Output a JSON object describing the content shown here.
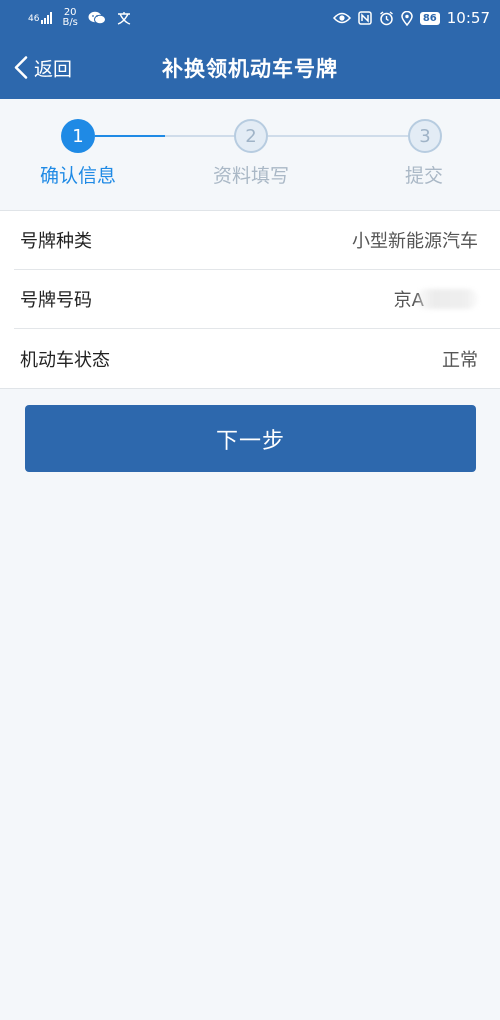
{
  "status_bar": {
    "signal_label": "46",
    "net_speed_value": "20",
    "net_speed_unit": "B/s",
    "battery": "86",
    "time": "10:57"
  },
  "nav": {
    "back_label": "返回",
    "title": "补换领机动车号牌"
  },
  "stepper": {
    "steps": [
      {
        "number": "1",
        "label": "确认信息",
        "state": "active"
      },
      {
        "number": "2",
        "label": "资料填写",
        "state": "inactive"
      },
      {
        "number": "3",
        "label": "提交",
        "state": "inactive"
      }
    ]
  },
  "info": {
    "rows": [
      {
        "key": "号牌种类",
        "value": "小型新能源汽车"
      },
      {
        "key": "号牌号码",
        "value": "京A"
      },
      {
        "key": "机动车状态",
        "value": "正常"
      }
    ]
  },
  "next_button_label": "下一步",
  "colors": {
    "brand": "#2d68ad",
    "active_step": "#1f8ae5",
    "inactive_step": "#aab8c6"
  }
}
